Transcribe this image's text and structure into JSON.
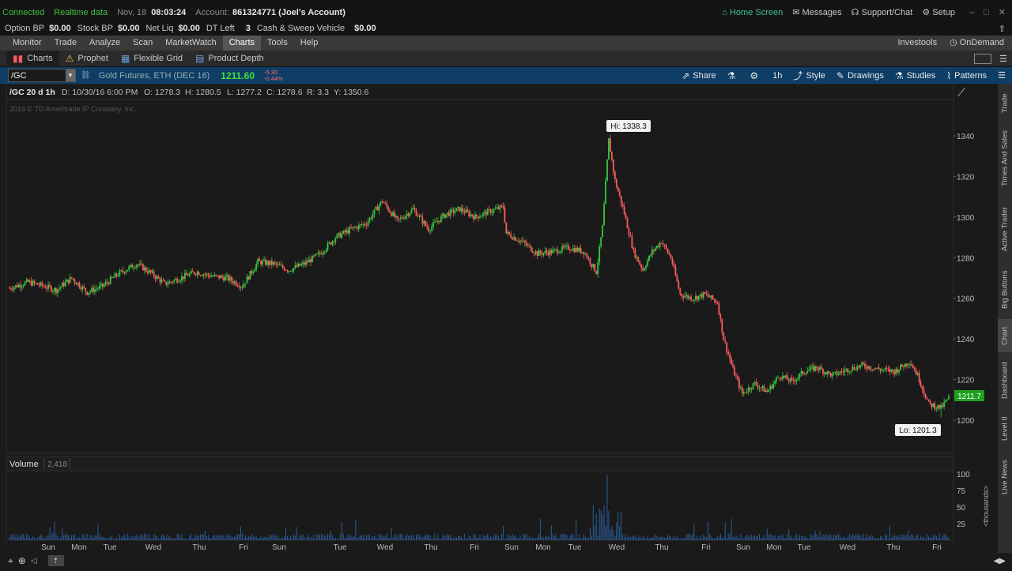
{
  "status": {
    "connected": "Connected",
    "realtime": "Realtime data",
    "date": "Nov, 18",
    "time": "08:03:24",
    "account_label": "Account:",
    "account_value": "861324771 (Joel's Account)",
    "home_screen": "Home Screen",
    "messages": "Messages",
    "support": "Support/Chat",
    "setup": "Setup"
  },
  "balances": [
    {
      "label": "Option BP",
      "value": "$0.00"
    },
    {
      "label": "Stock BP",
      "value": "$0.00"
    },
    {
      "label": "Net Liq",
      "value": "$0.00"
    },
    {
      "label": "DT Left",
      "value": "3"
    },
    {
      "label": "Cash & Sweep Vehicle",
      "value": "$0.00"
    }
  ],
  "menu": {
    "items": [
      "Monitor",
      "Trade",
      "Analyze",
      "Scan",
      "MarketWatch",
      "Charts",
      "Tools",
      "Help"
    ],
    "active": "Charts",
    "investools": "Investools",
    "ondemand": "OnDemand"
  },
  "subtabs": {
    "items": [
      "Charts",
      "Prophet",
      "Flexible Grid",
      "Product Depth"
    ],
    "active": "Charts"
  },
  "symbol_bar": {
    "symbol": "/GC",
    "description": "Gold Futures, ETH (DEC 16)",
    "last": "1211.60",
    "change": "-5.30",
    "change_pct": "-0.44%",
    "share": "Share",
    "timeframe": "1h",
    "style": "Style",
    "drawings": "Drawings",
    "studies": "Studies",
    "patterns": "Patterns"
  },
  "ohlc_bar": {
    "title": "/GC 20 d 1h",
    "date": "D: 10/30/16 6:00 PM",
    "open": "O: 1278.3",
    "high": "H: 1280.5",
    "low": "L: 1277.2",
    "close": "C: 1278.6",
    "range": "R: 3.3",
    "y": "Y: 1350.6"
  },
  "copyright": "2016 © TD Ameritrade IP Company, Inc.",
  "price_panel": {
    "hi_label": "Hi: 1338.3",
    "lo_label": "Lo: 1201.3",
    "last_label": "1211.7",
    "y_ticks": [
      "1340",
      "1320",
      "1300",
      "1280",
      "1260",
      "1240",
      "1220",
      "1200"
    ]
  },
  "volume_panel": {
    "label": "Volume",
    "value": "2,418",
    "y_ticks": [
      "100",
      "75",
      "50",
      "25"
    ],
    "unit": "<thousands>"
  },
  "x_labels": [
    "Sun",
    "Mon",
    "Tue",
    "Wed",
    "Thu",
    "Fri",
    "Sun",
    "Tue",
    "Wed",
    "Thu",
    "Fri",
    "Sun",
    "Mon",
    "Tue",
    "Wed",
    "Thu",
    "Fri",
    "Sun",
    "Mon",
    "Tue",
    "Wed",
    "Thu",
    "Fri"
  ],
  "right_tabs": [
    "Trade",
    "Times And Sales",
    "Active Trader",
    "Big Buttons",
    "Chart",
    "Dashboard",
    "Level II",
    "Live News"
  ],
  "colors": {
    "up": "#2ecc40",
    "down": "#ff5c5c",
    "accent": "#0e3e66",
    "last_bg": "#1fa01f"
  },
  "chart_data": {
    "type": "candlestick",
    "symbol": "/GC",
    "timeframe": "20 d 1h",
    "ylim": [
      1195,
      1350
    ],
    "hi": 1338.3,
    "lo": 1201.3,
    "last": 1211.7,
    "anchors": [
      [
        0,
        1265
      ],
      [
        12,
        1268
      ],
      [
        22,
        1266
      ],
      [
        30,
        1264
      ],
      [
        40,
        1270
      ],
      [
        50,
        1263
      ],
      [
        60,
        1266
      ],
      [
        70,
        1272
      ],
      [
        82,
        1277
      ],
      [
        92,
        1272
      ],
      [
        100,
        1267
      ],
      [
        110,
        1270
      ],
      [
        120,
        1273
      ],
      [
        130,
        1271
      ],
      [
        140,
        1270
      ],
      [
        150,
        1266
      ],
      [
        160,
        1278
      ],
      [
        170,
        1277
      ],
      [
        180,
        1274
      ],
      [
        190,
        1277
      ],
      [
        200,
        1282
      ],
      [
        210,
        1290
      ],
      [
        220,
        1294
      ],
      [
        230,
        1297
      ],
      [
        240,
        1308
      ],
      [
        250,
        1298
      ],
      [
        260,
        1304
      ],
      [
        270,
        1294
      ],
      [
        280,
        1301
      ],
      [
        290,
        1304
      ],
      [
        300,
        1300
      ],
      [
        310,
        1303
      ],
      [
        318,
        1305
      ],
      [
        320,
        1292
      ],
      [
        330,
        1288
      ],
      [
        340,
        1282
      ],
      [
        350,
        1283
      ],
      [
        360,
        1285
      ],
      [
        370,
        1283
      ],
      [
        378,
        1273
      ],
      [
        382,
        1295
      ],
      [
        386,
        1338
      ],
      [
        390,
        1318
      ],
      [
        396,
        1302
      ],
      [
        402,
        1283
      ],
      [
        408,
        1274
      ],
      [
        414,
        1283
      ],
      [
        420,
        1288
      ],
      [
        426,
        1280
      ],
      [
        432,
        1262
      ],
      [
        440,
        1260
      ],
      [
        448,
        1262
      ],
      [
        456,
        1258
      ],
      [
        460,
        1240
      ],
      [
        466,
        1225
      ],
      [
        472,
        1213
      ],
      [
        480,
        1218
      ],
      [
        488,
        1214
      ],
      [
        496,
        1222
      ],
      [
        504,
        1219
      ],
      [
        512,
        1224
      ],
      [
        520,
        1226
      ],
      [
        530,
        1222
      ],
      [
        540,
        1225
      ],
      [
        550,
        1227
      ],
      [
        560,
        1225
      ],
      [
        570,
        1224
      ],
      [
        580,
        1229
      ],
      [
        585,
        1222
      ],
      [
        592,
        1208
      ],
      [
        600,
        1206
      ],
      [
        605,
        1211
      ]
    ],
    "volume_ylim": [
      0,
      100
    ]
  }
}
